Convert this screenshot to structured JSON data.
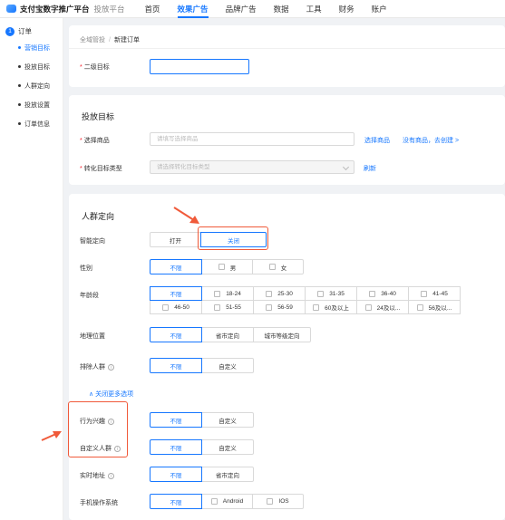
{
  "topbar": {
    "brand": "支付宝数字推广平台",
    "sub": "投放平台",
    "nav": [
      "首页",
      "效果广告",
      "品牌广告",
      "数据",
      "工具",
      "财务",
      "账户"
    ],
    "active_index": 1
  },
  "sidebar": {
    "step_num": "1",
    "step_label": "订单",
    "items": [
      "营销目标",
      "投放目标",
      "人群定向",
      "投放设置",
      "订单信息"
    ],
    "active_index": 0
  },
  "breadcrumb": {
    "root": "全域管投",
    "sep": "/",
    "current": "新建订单"
  },
  "secondary_target": {
    "label": "二级目标"
  },
  "target_section": {
    "title": "投放目标",
    "product_label": "选择商品",
    "product_placeholder": "请填写选择商品",
    "product_link": "选择商品",
    "no_product_link": "没有商品，去创建 >",
    "convert_label": "转化目标类型",
    "convert_placeholder": "请选择转化目标类型",
    "refresh_link": "刷新"
  },
  "audience": {
    "title": "人群定向",
    "smart": {
      "label": "智能定向",
      "options": [
        "打开",
        "关闭"
      ],
      "selected": 1
    },
    "gender": {
      "label": "性别",
      "options": [
        "不限",
        "男",
        "女"
      ],
      "selected": 0
    },
    "age": {
      "label": "年龄段",
      "options": [
        "不限",
        "18-24",
        "25-30",
        "31-35",
        "36-40",
        "41-45",
        "46-50",
        "51-55",
        "56-59",
        "60及以上",
        "24及以...",
        "56及以..."
      ],
      "selected": 0
    },
    "location": {
      "label": "地理位置",
      "options": [
        "不限",
        "省市定向",
        "城市等级定向"
      ],
      "selected": 0
    },
    "exclude": {
      "label": "排除人群",
      "options": [
        "不限",
        "自定义"
      ],
      "selected": 0
    },
    "collapse_link": "∧ 关闭更多选项",
    "behavior": {
      "label": "行为兴趣",
      "options": [
        "不限",
        "自定义"
      ],
      "selected": 0
    },
    "custom_crowd": {
      "label": "自定义人群",
      "options": [
        "不限",
        "自定义"
      ],
      "selected": 0
    },
    "realtime": {
      "label": "实时地址",
      "options": [
        "不限",
        "省市定向"
      ],
      "selected": 0
    },
    "os": {
      "label": "手机操作系统",
      "options": [
        "不限",
        "Android",
        "IOS"
      ],
      "selected": 0
    }
  },
  "colors": {
    "accent": "#1677ff",
    "highlight": "#f05a3a",
    "required": "#f5222d"
  }
}
